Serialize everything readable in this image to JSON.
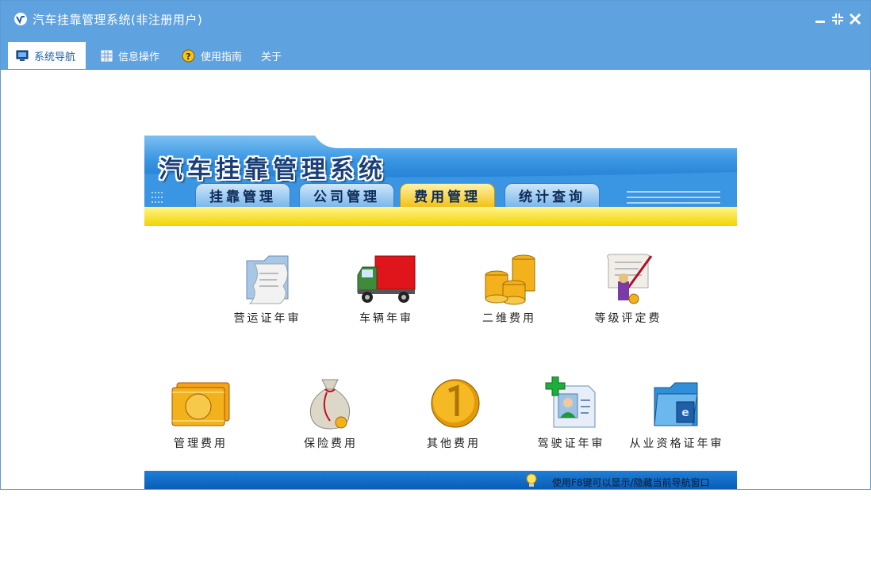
{
  "window": {
    "title": "汽车挂靠管理系统(非注册用户)"
  },
  "menu": {
    "tabs": [
      {
        "label": "系统导航",
        "icon": "monitor-icon",
        "active": true
      },
      {
        "label": "信息操作",
        "icon": "grid-icon",
        "active": false
      },
      {
        "label": "使用指南",
        "icon": "help-icon",
        "active": false
      },
      {
        "label": "关于",
        "icon": "",
        "active": false
      }
    ]
  },
  "banner": {
    "title": "汽车挂靠管理系统",
    "tabs": [
      {
        "label": "挂靠管理",
        "active": false
      },
      {
        "label": "公司管理",
        "active": false
      },
      {
        "label": "费用管理",
        "active": true
      },
      {
        "label": "统计查询",
        "active": false
      }
    ]
  },
  "items": [
    {
      "label": "营运证年审",
      "icon": "document-folder-icon"
    },
    {
      "label": "车辆年审",
      "icon": "truck-icon"
    },
    {
      "label": "二维费用",
      "icon": "coin-stack-icon"
    },
    {
      "label": "等级评定费",
      "icon": "certificate-icon"
    },
    {
      "label": "管理费用",
      "icon": "cash-icon"
    },
    {
      "label": "保险费用",
      "icon": "money-bag-icon"
    },
    {
      "label": "其他费用",
      "icon": "gold-coin-icon"
    },
    {
      "label": "驾驶证年审",
      "icon": "driver-license-icon"
    },
    {
      "label": "从业资格证年审",
      "icon": "blue-folder-icon"
    }
  ],
  "footer": {
    "tip": "使用F8键可以显示/隐藏当前导航窗口"
  },
  "colors": {
    "titlebar": "#5fa2e0",
    "banner_blue": "#2f8be0",
    "banner_yellow": "#f7e400",
    "active_tab": "#f2c21a"
  }
}
